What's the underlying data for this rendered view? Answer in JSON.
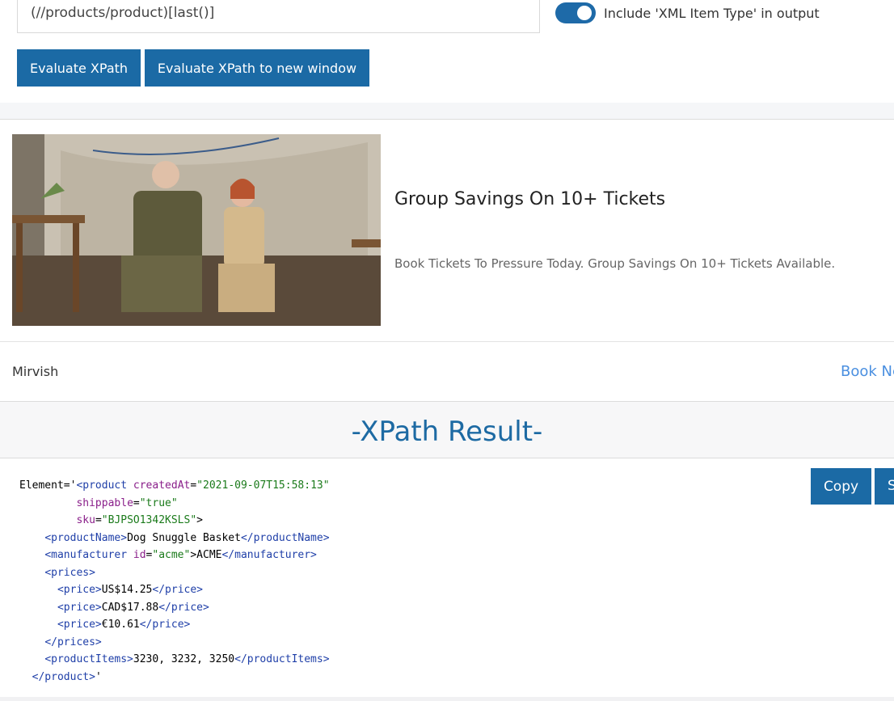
{
  "form": {
    "xpath_value": "(//products/product)[last()]",
    "toggle_label": "Include 'XML Item Type' in output",
    "toggle_on": true,
    "evaluate_label": "Evaluate XPath",
    "evaluate_new_window_label": "Evaluate XPath to new window"
  },
  "ad": {
    "title": "Group Savings On 10+ Tickets",
    "description": "Book Tickets To Pressure Today. Group Savings On 10+ Tickets Available.",
    "brand": "Mirvish",
    "cta": "Book Nc"
  },
  "result": {
    "title": "-XPath Result-",
    "copy_label": "Copy",
    "save_label": "S",
    "lines": {
      "l1_prefix": "Element='",
      "l1_tag": "<product",
      "l1_attr": "createdAt",
      "l1_val": "\"2021-09-07T15:58:13\"",
      "l2_attr": "shippable",
      "l2_val": "\"true\"",
      "l3_attr": "sku",
      "l3_val": "\"BJPSO1342KSLS\"",
      "l3_end": ">",
      "product_name_open": "<productName>",
      "product_name_text": "Dog Snuggle Basket",
      "product_name_close": "</productName>",
      "manufacturer_open": "<manufacturer",
      "manufacturer_attr": "id",
      "manufacturer_val": "\"acme\"",
      "manufacturer_text": ">ACME",
      "manufacturer_close": "</manufacturer>",
      "prices_open": "<prices>",
      "price1_open": "<price>",
      "price1_text": "US$14.25",
      "price1_close": "</price>",
      "price2_open": "<price>",
      "price2_text": "CAD$17.88",
      "price2_close": "</price>",
      "price3_open": "<price>",
      "price3_text": "€10.61",
      "price3_close": "</price>",
      "prices_close": "</prices>",
      "items_open": "<productItems>",
      "items_text": "3230, 3232, 3250",
      "items_close": "</productItems>",
      "product_close": "</product>",
      "end_quote": "'"
    }
  }
}
